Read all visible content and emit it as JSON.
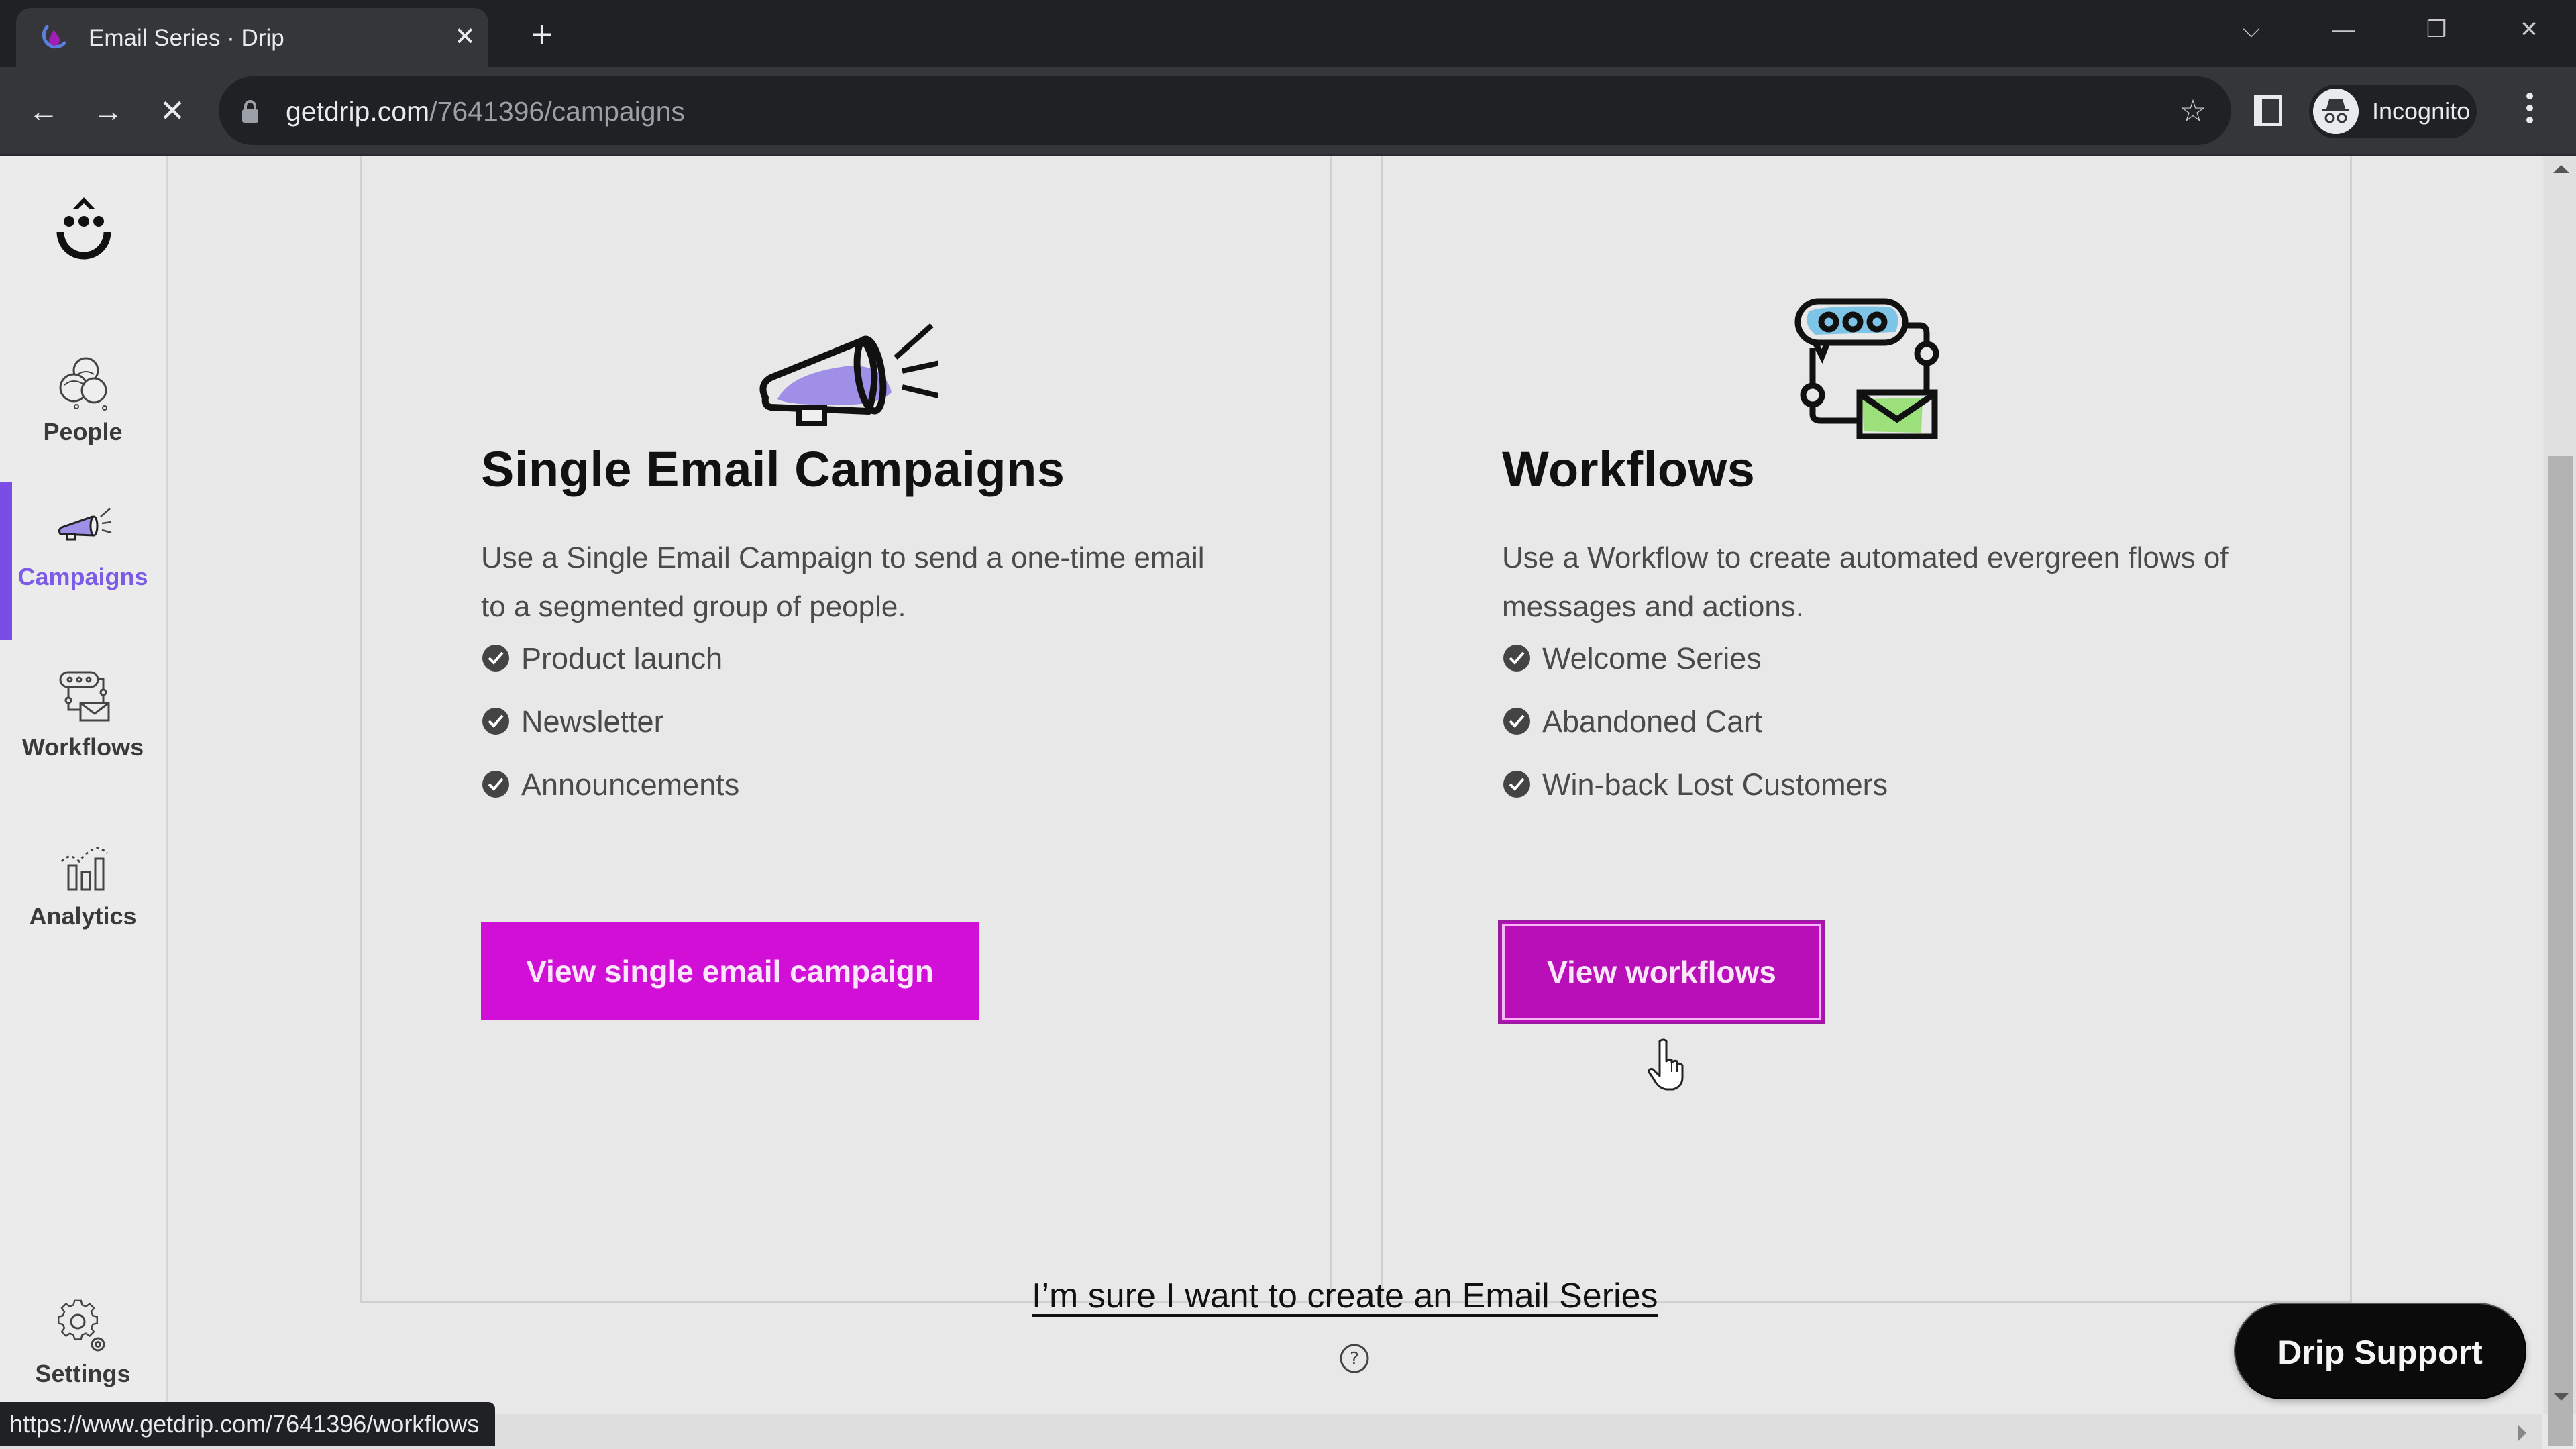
{
  "browser": {
    "tab": {
      "title": "Email Series · Drip",
      "favicon": "drip-favicon-icon",
      "close_glyph": "✕"
    },
    "new_tab_glyph": "+",
    "window_controls": {
      "tab_search": "⌵",
      "minimize": "—",
      "restore": "❐",
      "close": "✕"
    },
    "nav": {
      "back": "←",
      "forward": "→",
      "stop": "✕"
    },
    "url": {
      "host": "getdrip.com",
      "path": "/7641396/campaigns"
    },
    "bookmark_glyph": "☆",
    "profile_label": "Incognito",
    "status_url": "https://www.getdrip.com/7641396/workflows"
  },
  "sidebar": {
    "logo": "drip-logo-icon",
    "items": [
      {
        "label": "People",
        "icon": "people-icon",
        "active": false
      },
      {
        "label": "Campaigns",
        "icon": "megaphone-icon",
        "active": true
      },
      {
        "label": "Workflows",
        "icon": "workflow-icon",
        "active": false
      },
      {
        "label": "Analytics",
        "icon": "analytics-icon",
        "active": false
      }
    ],
    "settings": {
      "label": "Settings",
      "icon": "gear-icon"
    }
  },
  "cards": [
    {
      "title": "Single Email Campaigns",
      "description": "Use a Single Email Campaign to send a one-time email to a segmented group of people.",
      "features": [
        "Product launch",
        "Newsletter",
        "Announcements"
      ],
      "cta": "View single email campaign",
      "illustration": "megaphone-illustration"
    },
    {
      "title": "Workflows",
      "description": "Use a Workflow to create automated evergreen flows of messages and actions.",
      "features": [
        "Welcome Series",
        "Abandoned Cart",
        "Win-back Lost Customers"
      ],
      "cta": "View workflows",
      "illustration": "workflow-illustration"
    }
  ],
  "series_link": "I’m sure I want to create an Email Series",
  "help_glyph": "?",
  "support_button": "Drip Support",
  "colors": {
    "accent_purple": "#7a4ee6",
    "cta_magenta": "#d20fd6",
    "cta_hover": "#b80fb8",
    "illustration_purple": "#a08fe6",
    "illustration_blue": "#7ec4e6",
    "illustration_green": "#9be07a"
  },
  "scrollbar": {
    "vertical_position_percent": 20
  }
}
